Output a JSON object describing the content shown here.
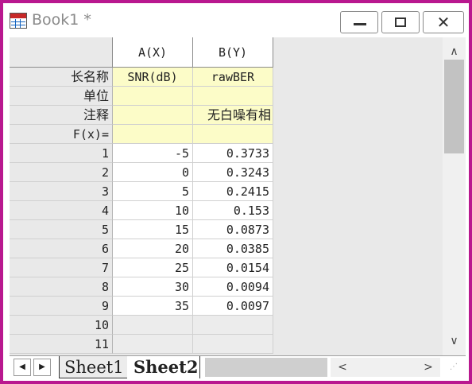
{
  "window": {
    "title": "Book1 *",
    "close_glyph": "✕"
  },
  "columns": [
    {
      "header": "A(X)",
      "long_name": "SNR(dB)",
      "unit": "",
      "comment": "",
      "formula": ""
    },
    {
      "header": "B(Y)",
      "long_name": "rawBER",
      "unit": "",
      "comment": "无白噪有相",
      "formula": ""
    }
  ],
  "meta_labels": {
    "long_name": "长名称",
    "unit": "单位",
    "comment": "注释",
    "formula": "F(x)="
  },
  "rows": [
    {
      "index": "1",
      "a": "-5",
      "b": "0.3733"
    },
    {
      "index": "2",
      "a": "0",
      "b": "0.3243"
    },
    {
      "index": "3",
      "a": "5",
      "b": "0.2415"
    },
    {
      "index": "4",
      "a": "10",
      "b": "0.153"
    },
    {
      "index": "5",
      "a": "15",
      "b": "0.0873"
    },
    {
      "index": "6",
      "a": "20",
      "b": "0.0385"
    },
    {
      "index": "7",
      "a": "25",
      "b": "0.0154"
    },
    {
      "index": "8",
      "a": "30",
      "b": "0.0094"
    },
    {
      "index": "9",
      "a": "35",
      "b": "0.0097"
    },
    {
      "index": "10",
      "a": "",
      "b": ""
    },
    {
      "index": "11",
      "a": "",
      "b": ""
    }
  ],
  "tabs": [
    {
      "label": "Sheet1",
      "active": false
    },
    {
      "label": "Sheet2",
      "active": true
    }
  ],
  "nav": {
    "prev": "◀",
    "next": "▶"
  },
  "scroll": {
    "up": "∧",
    "down": "∨",
    "left": "<",
    "right": ">"
  },
  "colors": {
    "window_border": "#b9188f",
    "meta_fill": "#fcfcc8"
  }
}
